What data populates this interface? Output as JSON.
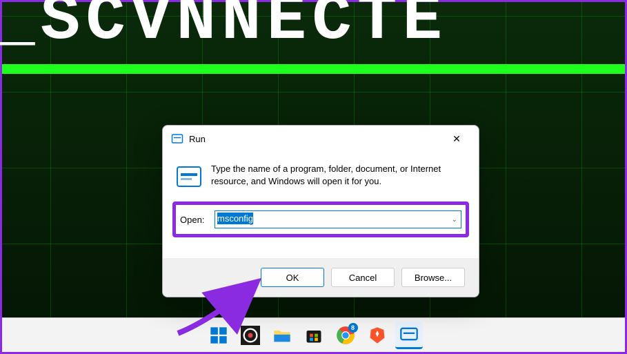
{
  "desktop": {
    "bg_text": "_SCVNNECTE"
  },
  "dialog": {
    "title": "Run",
    "instruction": "Type the name of a program, folder, document, or Internet resource, and Windows will open it for you.",
    "open_label": "Open:",
    "input_value": "msconfig",
    "buttons": {
      "ok": "OK",
      "cancel": "Cancel",
      "browse": "Browse..."
    }
  },
  "taskbar": {
    "chrome_badge": "8"
  },
  "annotation": {
    "highlight_color": "#8a2be2"
  }
}
